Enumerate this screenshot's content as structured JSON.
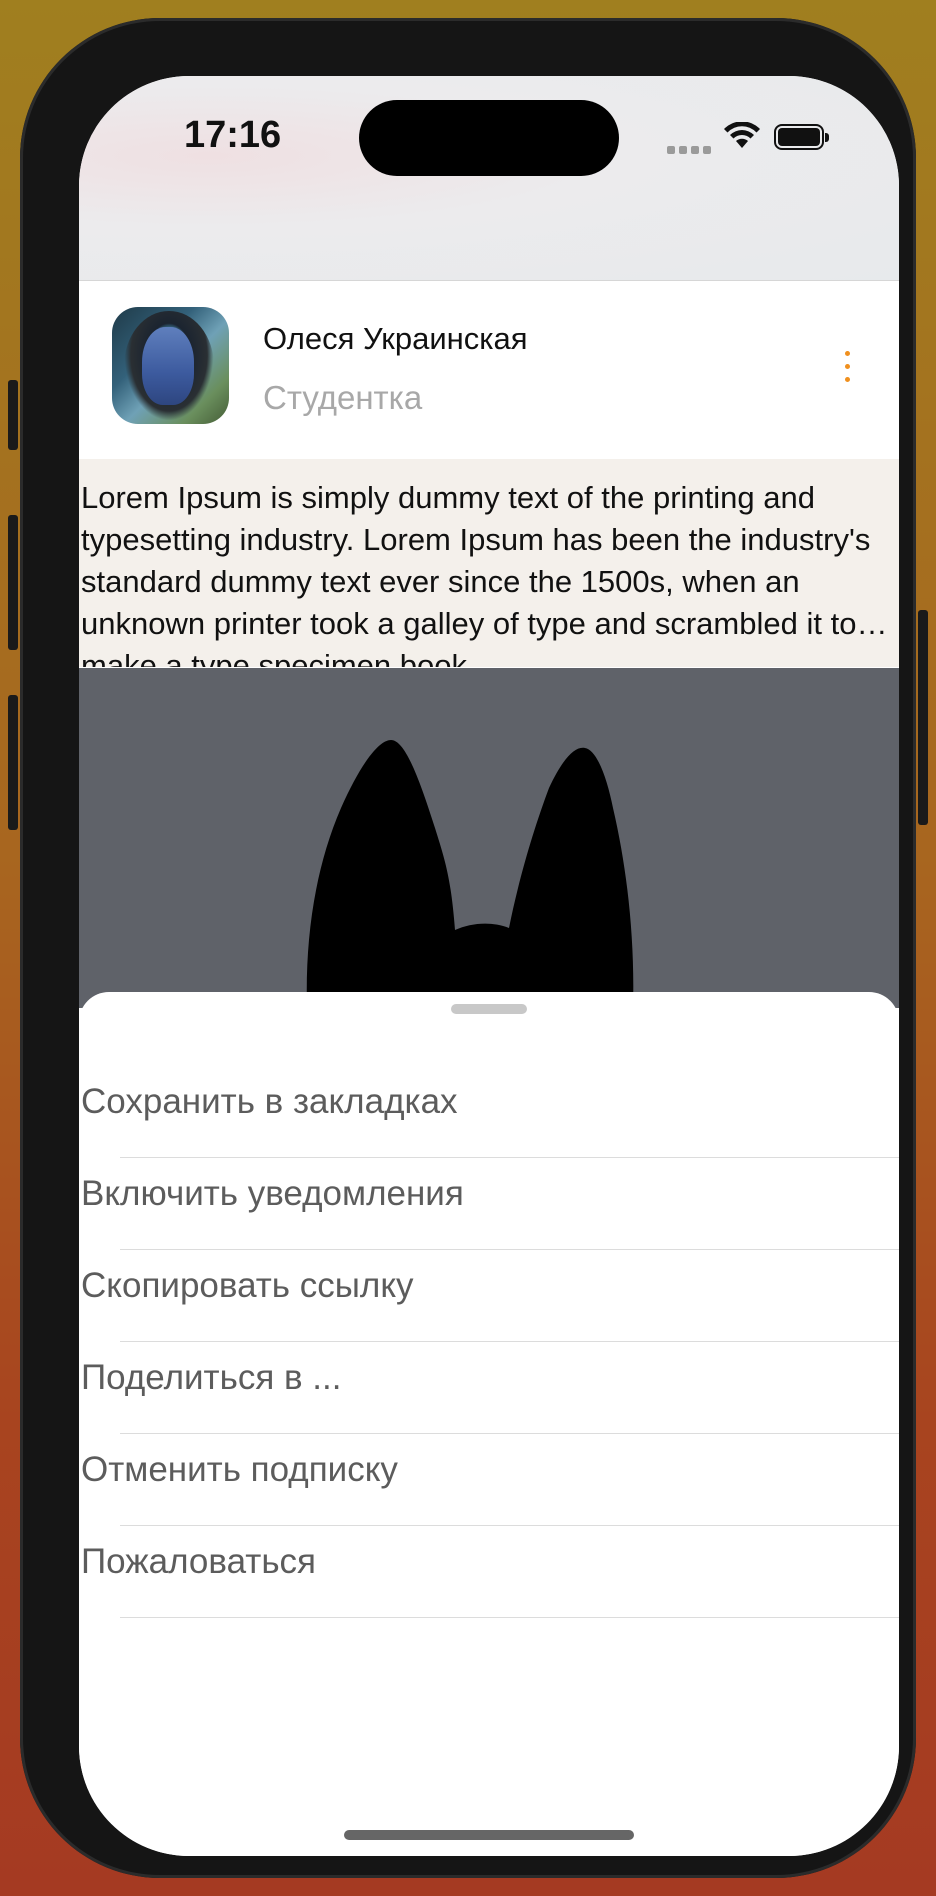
{
  "status_bar": {
    "time": "17:16",
    "icons": [
      "cellular-signal-icon",
      "wifi-icon",
      "battery-icon"
    ]
  },
  "post": {
    "author": {
      "name": "Олеся Украинская",
      "role": "Студентка",
      "avatar": "avatar-image"
    },
    "more_icon": "vertical-ellipsis-icon",
    "text": "Lorem Ipsum is simply dummy text of the printing and typesetting industry. Lorem Ipsum has been the industry's standard dummy text ever since the 1500s, when an unknown printer took a galley of type and scrambled it to make a type specimen book.",
    "image": "cat-ears-silhouette"
  },
  "action_sheet": {
    "items": [
      {
        "label": "Сохранить в закладках"
      },
      {
        "label": "Включить уведомления"
      },
      {
        "label": "Скопировать ссылку"
      },
      {
        "label": "Поделиться в ..."
      },
      {
        "label": "Отменить подписку"
      },
      {
        "label": "Пожаловаться"
      }
    ]
  },
  "colors": {
    "accent": "#f0901e",
    "menu_text": "#5c5c5c",
    "post_text_bg": "#f4f0eb",
    "image_bg": "#5f6269"
  }
}
